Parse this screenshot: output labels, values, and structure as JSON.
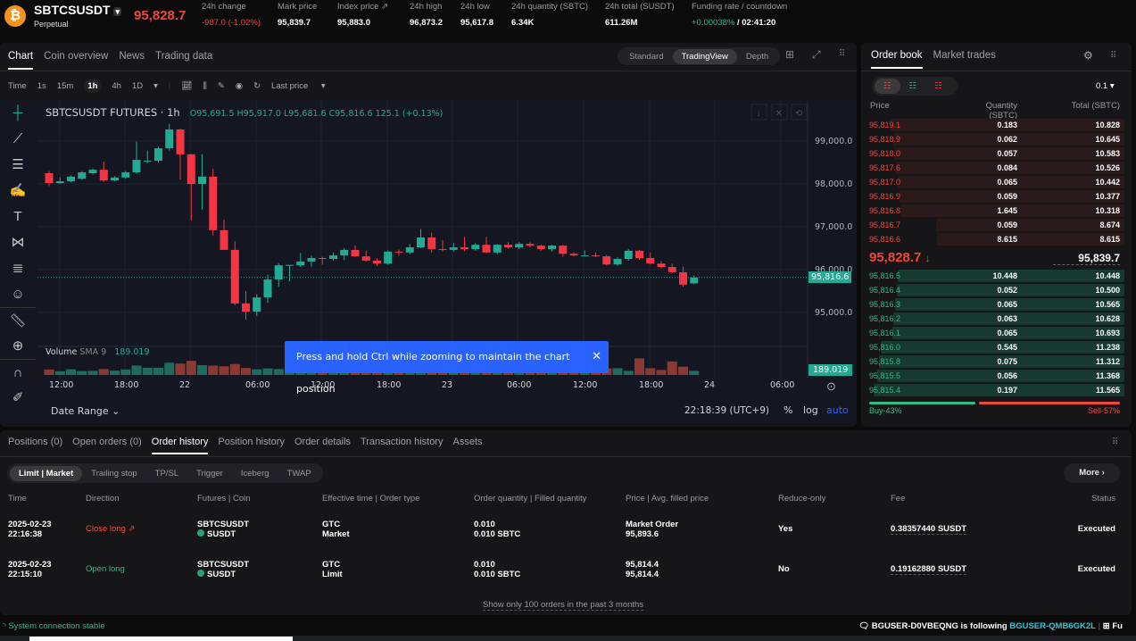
{
  "header": {
    "symbol": "SBTCSUSDT",
    "type": "Perpetual",
    "last_price": "95,828.7",
    "stats": [
      {
        "label": "24h change",
        "value": "-987.0 (-1.02%)",
        "color": "#f0463c"
      },
      {
        "label": "Mark price",
        "value": "95,839.7"
      },
      {
        "label": "Index price",
        "value": "95,883.0"
      },
      {
        "label": "24h high",
        "value": "96,873.2"
      },
      {
        "label": "24h low",
        "value": "95,617.8"
      },
      {
        "label": "24h quantity (SBTC)",
        "value": "6.34K"
      },
      {
        "label": "24h total (SUSDT)",
        "value": "611.26M"
      },
      {
        "label": "Funding rate / countdown",
        "value": "+0.00038%",
        "value2": " / 02:41:20",
        "color": "#2ebd85"
      }
    ]
  },
  "chart_tabs": [
    "Chart",
    "Coin overview",
    "News",
    "Trading data"
  ],
  "view_modes": [
    "Standard",
    "TradingView",
    "Depth"
  ],
  "toolbar": {
    "time": "Time",
    "intervals": [
      "1s",
      "15m",
      "1h",
      "4h",
      "1D"
    ],
    "price_type": "Last price"
  },
  "legend": {
    "title": "SBTCSUSDT FUTURES · 1h",
    "o": "95,691.5",
    "h": "95,917.0",
    "l": "95,681.6",
    "c": "95,816.6",
    "chg": "125.1 (+0.13%)"
  },
  "volume_legend": {
    "label": "Volume",
    "sma": "SMA 9",
    "value": "189.019"
  },
  "price_axis": [
    "99,000.0",
    "98,000.0",
    "97,000.0",
    "96,000.0",
    "95,000.0"
  ],
  "current_price_tag": "95,816.6",
  "volume_tag": "189.019",
  "time_axis": [
    "12:00",
    "18:00",
    "22",
    "06:00",
    "12:00",
    "18:00",
    "23",
    "06:00",
    "12:00",
    "18:00",
    "24",
    "06:00"
  ],
  "toast": "Press and hold Ctrl while zooming to maintain the chart position",
  "chart_footer": {
    "date_range": "Date Range",
    "clock": "22:18:39 (UTC+9)",
    "pct": "%",
    "log": "log",
    "auto": "auto"
  },
  "chart_data": {
    "type": "candlestick",
    "interval": "1h",
    "start": "21 11:00",
    "ohlc": [
      [
        98250,
        98300,
        97950,
        98020
      ],
      [
        98020,
        98150,
        98000,
        98060
      ],
      [
        98060,
        98200,
        98040,
        98170
      ],
      [
        98120,
        98300,
        98100,
        98270
      ],
      [
        98250,
        98360,
        98220,
        98330
      ],
      [
        98330,
        98520,
        98050,
        98080
      ],
      [
        98080,
        98180,
        98060,
        98150
      ],
      [
        98150,
        98300,
        98120,
        98270
      ],
      [
        98270,
        98990,
        98240,
        98560
      ],
      [
        98520,
        98780,
        98480,
        98540
      ],
      [
        98540,
        98870,
        98500,
        98830
      ],
      [
        98830,
        99400,
        98780,
        99270
      ],
      [
        99270,
        99290,
        98100,
        98690
      ],
      [
        98690,
        98700,
        97150,
        98000
      ],
      [
        98000,
        98690,
        97400,
        98170
      ],
      [
        98170,
        98350,
        96800,
        96920
      ],
      [
        96920,
        97170,
        96750,
        96460
      ],
      [
        96460,
        96660,
        95170,
        95210
      ],
      [
        95210,
        95500,
        94830,
        95020
      ],
      [
        95020,
        95430,
        94920,
        95350
      ],
      [
        95350,
        95880,
        95230,
        95770
      ],
      [
        95770,
        96150,
        95600,
        96100
      ],
      [
        96100,
        96100,
        95730,
        96110
      ],
      [
        96100,
        96390,
        96060,
        96190
      ],
      [
        96190,
        96330,
        96070,
        96270
      ],
      [
        96270,
        96300,
        96110,
        96250
      ],
      [
        96250,
        96400,
        96210,
        96330
      ],
      [
        96330,
        96500,
        96220,
        96460
      ],
      [
        96460,
        96560,
        96290,
        96310
      ],
      [
        96310,
        96440,
        96190,
        96210
      ],
      [
        96210,
        96260,
        96090,
        96140
      ],
      [
        96140,
        96450,
        96110,
        96420
      ],
      [
        96420,
        96470,
        96320,
        96400
      ],
      [
        96400,
        96600,
        96360,
        96520
      ],
      [
        96520,
        96950,
        96500,
        96750
      ],
      [
        96750,
        96860,
        96400,
        96480
      ],
      [
        96480,
        96690,
        96420,
        96460
      ],
      [
        96460,
        96620,
        96420,
        96520
      ],
      [
        96520,
        96760,
        96430,
        96480
      ],
      [
        96480,
        96620,
        96440,
        96580
      ],
      [
        96580,
        96760,
        96380,
        96400
      ],
      [
        96400,
        96600,
        96360,
        96580
      ],
      [
        96580,
        96640,
        96490,
        96520
      ],
      [
        96520,
        96640,
        96480,
        96600
      ],
      [
        96600,
        96640,
        96520,
        96560
      ],
      [
        96560,
        96580,
        96440,
        96480
      ],
      [
        96480,
        96580,
        96430,
        96560
      ],
      [
        96560,
        96580,
        96300,
        96370
      ],
      [
        96370,
        96400,
        96310,
        96330
      ],
      [
        96330,
        96450,
        96310,
        96330
      ],
      [
        96330,
        96400,
        96290,
        96310
      ],
      [
        96310,
        96340,
        96100,
        96120
      ],
      [
        96120,
        96290,
        96080,
        96250
      ],
      [
        96250,
        96480,
        96210,
        96440
      ],
      [
        96440,
        96460,
        96230,
        96270
      ],
      [
        96270,
        96400,
        96120,
        96140
      ],
      [
        96140,
        96200,
        96030,
        96060
      ],
      [
        96060,
        96140,
        95920,
        95940
      ],
      [
        95940,
        96070,
        95600,
        95650
      ],
      [
        95680,
        95860,
        95660,
        95816.6
      ]
    ],
    "volume": [
      250,
      170,
      260,
      180,
      190,
      270,
      200,
      250,
      430,
      330,
      330,
      560,
      520,
      650,
      450,
      430,
      400,
      500,
      320,
      260,
      300,
      270,
      220,
      160,
      150,
      170,
      180,
      190,
      210,
      170,
      160,
      170,
      160,
      180,
      200,
      220,
      170,
      180,
      180,
      190,
      200,
      170,
      160,
      170,
      160,
      170,
      220,
      190,
      170,
      150,
      160,
      300,
      310,
      190,
      760,
      310,
      230,
      620,
      380,
      189.019
    ],
    "ylim": [
      94500,
      99500
    ]
  },
  "orderbook": {
    "tabs": [
      "Order book",
      "Market trades"
    ],
    "precision": "0.1",
    "headers": [
      "Price",
      "Quantity (SBTC)",
      "Total (SBTC)"
    ],
    "asks": [
      [
        "95,819.1",
        "0.183",
        "10.828"
      ],
      [
        "95,818.9",
        "0.062",
        "10.645"
      ],
      [
        "95,818.0",
        "0.057",
        "10.583"
      ],
      [
        "95,817.6",
        "0.084",
        "10.526"
      ],
      [
        "95,817.0",
        "0.065",
        "10.442"
      ],
      [
        "95,816.9",
        "0.059",
        "10.377"
      ],
      [
        "95,816.8",
        "1.645",
        "10.318"
      ],
      [
        "95,816.7",
        "0.059",
        "8.674"
      ],
      [
        "95,816.6",
        "8.615",
        "8.615"
      ]
    ],
    "mid_price": "95,828.7",
    "mark_price": "95,839.7",
    "bids": [
      [
        "95,816.5",
        "10.448",
        "10.448"
      ],
      [
        "95,816.4",
        "0.052",
        "10.500"
      ],
      [
        "95,816.3",
        "0.065",
        "10.565"
      ],
      [
        "95,816.2",
        "0.063",
        "10.628"
      ],
      [
        "95,816.1",
        "0.065",
        "10.693"
      ],
      [
        "95,816.0",
        "0.545",
        "11.238"
      ],
      [
        "95,815.8",
        "0.075",
        "11.312"
      ],
      [
        "95,815.5",
        "0.056",
        "11.368"
      ],
      [
        "95,815.4",
        "0.197",
        "11.565"
      ]
    ],
    "buy_label": "Buy-43%",
    "sell_label": "Sell-57%",
    "buy_pct": 43
  },
  "bottom": {
    "tabs": [
      "Positions (0)",
      "Open orders (0)",
      "Order history",
      "Position history",
      "Order details",
      "Transaction history",
      "Assets"
    ],
    "subtabs": [
      "Limit | Market",
      "Trailing stop",
      "TP/SL",
      "Trigger",
      "Iceberg",
      "TWAP"
    ],
    "more": "More",
    "headers": [
      "Time",
      "Direction",
      "Futures | Coin",
      "Effective time | Order type",
      "Order quantity | Filled quantity",
      "Price | Avg. filled price",
      "Reduce-only",
      "Fee",
      "Status"
    ],
    "rows": [
      {
        "date": "2025-02-23",
        "time": "22:16:38",
        "direction": "Close long",
        "sym": "SBTCSUSDT",
        "coin": "SUSDT",
        "eff": "GTC",
        "otype": "Market",
        "qty": "0.010",
        "filled": "0.010 SBTC",
        "price": "Market Order",
        "avg": "95,893.6",
        "reduce": "Yes",
        "fee": "0.38357440 SUSDT",
        "status": "Executed"
      },
      {
        "date": "2025-02-23",
        "time": "22:15:10",
        "direction": "Open long",
        "sym": "SBTCSUSDT",
        "coin": "SUSDT",
        "eff": "GTC",
        "otype": "Limit",
        "qty": "0.010",
        "filled": "0.010 SBTC",
        "price": "95,814.4",
        "avg": "95,814.4",
        "reduce": "No",
        "fee": "0.19162880 SUSDT",
        "status": "Executed"
      }
    ],
    "note": "Show only 100 orders in the past 3 months"
  },
  "status": {
    "connection": "System connection stable",
    "follow_user": "BGUSER-D0VBEQNG",
    "follow_text": " is following ",
    "follow_target": "BGUSER-QMB6GK2L",
    "extra": "Fu"
  },
  "colors": {
    "up": "#22ab94",
    "down": "#f23645",
    "accent": "#2ebd85",
    "sell": "#f0463c"
  }
}
